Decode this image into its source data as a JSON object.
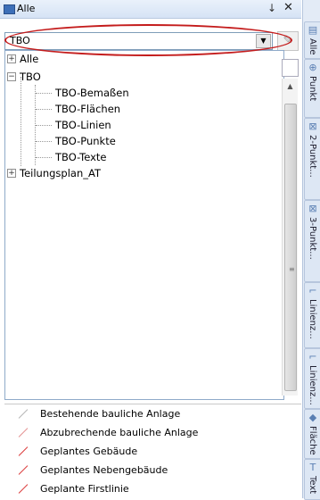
{
  "panel": {
    "title": "Alle",
    "pin_glyph": "↓",
    "close_glyph": "✕"
  },
  "combo": {
    "value": "TBO",
    "arrow_glyph": "▼"
  },
  "tree": {
    "nodes": [
      {
        "label": "Alle",
        "expander": "+"
      },
      {
        "label": "TBO",
        "expander": "−"
      },
      {
        "label": "TBO-Bemaßen"
      },
      {
        "label": "TBO-Flächen"
      },
      {
        "label": "TBO-Linien"
      },
      {
        "label": "TBO-Punkte"
      },
      {
        "label": "TBO-Texte"
      },
      {
        "label": "Teilungsplan_AT",
        "expander": "+"
      }
    ]
  },
  "legend": {
    "items": [
      {
        "label": "Bestehende bauliche Anlage",
        "color": "#b0b0b0"
      },
      {
        "label": "Abzubrechende bauliche Anlage",
        "color": "#e28a8a"
      },
      {
        "label": "Geplantes Gebäude",
        "color": "#d93030"
      },
      {
        "label": "Geplantes Nebengebäude",
        "color": "#d93030"
      },
      {
        "label": "Geplante Firstlinie",
        "color": "#d93030"
      }
    ]
  },
  "side_tabs": [
    {
      "label": "Alle",
      "icon": "layers-icon"
    },
    {
      "label": "Punkt",
      "icon": "point-icon"
    },
    {
      "label": "2-Punkt...",
      "icon": "two-point-icon"
    },
    {
      "label": "3-Punkt...",
      "icon": "three-point-icon"
    },
    {
      "label": "Linienz...",
      "icon": "polyline-icon"
    },
    {
      "label": "Linienz...",
      "icon": "polyline-icon"
    },
    {
      "label": "Fläche",
      "icon": "area-icon"
    },
    {
      "label": "Text",
      "icon": "text-icon"
    }
  ],
  "colors": {
    "highlight": "#c41c1c",
    "accent": "#3d6fb8"
  }
}
